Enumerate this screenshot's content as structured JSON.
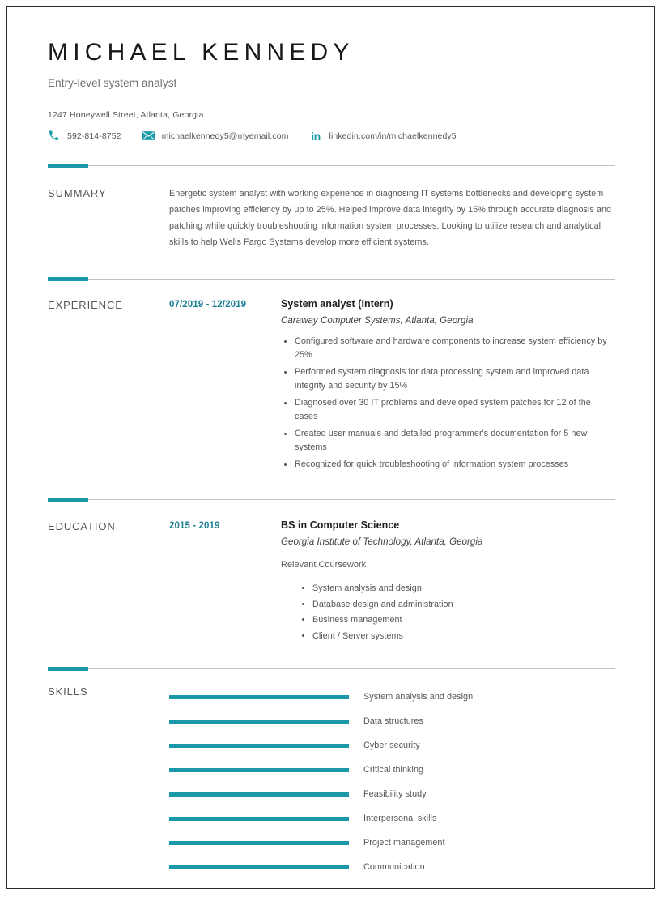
{
  "theme": {
    "accent": "#1a9aa8",
    "accent_dark": "#1a7f93",
    "text": "#55575b",
    "heading": "#16181c"
  },
  "header": {
    "name": "MICHAEL KENNEDY",
    "subtitle": "Entry-level system analyst",
    "address": "1247 Honeywell Street, Atlanta, Georgia",
    "contacts": [
      {
        "icon": "phone-icon",
        "value": "592-814-8752"
      },
      {
        "icon": "email-icon",
        "value": "michaelkennedy5@myemail.com"
      },
      {
        "icon": "linkedin-icon",
        "value": "linkedin.com/in/michaelkennedy5"
      }
    ]
  },
  "summary": {
    "label": "SUMMARY",
    "text": "Energetic system analyst with working experience in diagnosing IT systems bottlenecks and developing system patches improving efficiency by up to 25%. Helped improve data integrity by 15% through accurate diagnosis and patching while quickly troubleshooting information system processes. Looking to utilize research and analytical skills to help Wells Fargo Systems develop more efficient systems."
  },
  "experience": {
    "label": "EXPERIENCE",
    "date": "07/2019 - 12/2019",
    "title": "System analyst (Intern)",
    "organization": "Caraway Computer Systems, Atlanta, Georgia",
    "bullets": [
      "Configured software and hardware components to increase system efficiency by 25%",
      "Performed system diagnosis for data processing system and improved data integrity and security by 15%",
      "Diagnosed over 30 IT problems and developed system patches for 12 of the cases",
      "Created user manuals and detailed programmer's documentation for 5 new systems",
      "Recognized for quick troubleshooting of information system processes"
    ]
  },
  "education": {
    "label": "EDUCATION",
    "date": "2015 - 2019",
    "degree": "BS in Computer Science",
    "institution": "Georgia Institute of Technology, Atlanta, Georgia",
    "coursework_label": "Relevant Coursework",
    "coursework": [
      "System analysis and design",
      "Database design and administration",
      "Business management",
      "Client / Server systems"
    ]
  },
  "skills": {
    "label": "SKILLS",
    "items": [
      {
        "name": "System analysis and design",
        "level": 100
      },
      {
        "name": "Data structures",
        "level": 100
      },
      {
        "name": "Cyber security",
        "level": 100
      },
      {
        "name": "Critical thinking",
        "level": 100
      },
      {
        "name": "Feasibility study",
        "level": 100
      },
      {
        "name": "Interpersonal skills",
        "level": 100
      },
      {
        "name": "Project management",
        "level": 100
      },
      {
        "name": "Communication",
        "level": 100
      }
    ]
  }
}
